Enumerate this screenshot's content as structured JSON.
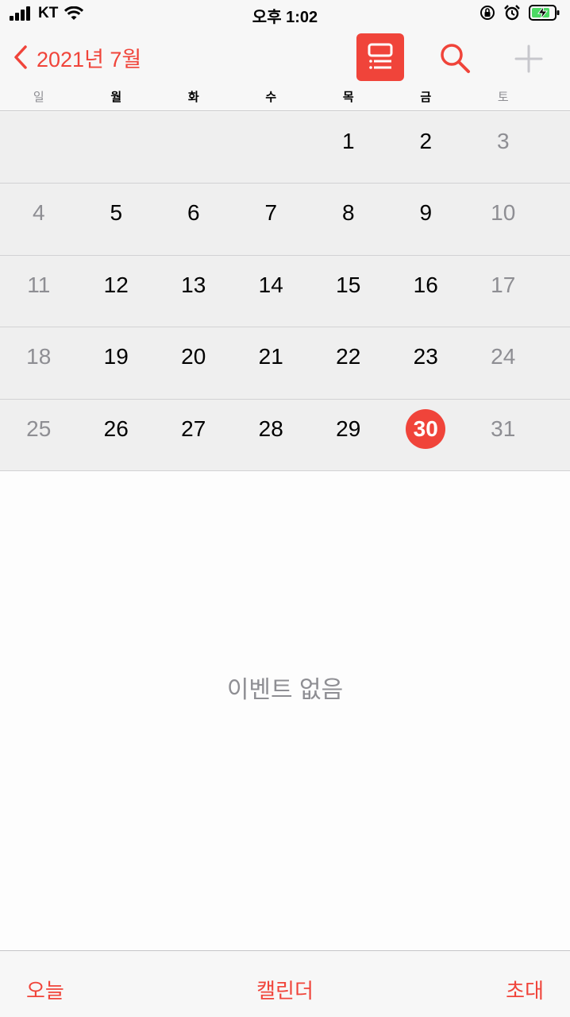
{
  "status_bar": {
    "carrier": "KT",
    "time": "오후 1:02"
  },
  "nav": {
    "back_label": "2021년 7월",
    "icons": [
      "chevron-left-icon",
      "list-view-icon",
      "search-icon",
      "plus-icon"
    ]
  },
  "weekdays": [
    "일",
    "월",
    "화",
    "수",
    "목",
    "금",
    "토"
  ],
  "weeks": [
    [
      "",
      "",
      "",
      "",
      "1",
      "2",
      "3"
    ],
    [
      "4",
      "5",
      "6",
      "7",
      "8",
      "9",
      "10"
    ],
    [
      "11",
      "12",
      "13",
      "14",
      "15",
      "16",
      "17"
    ],
    [
      "18",
      "19",
      "20",
      "21",
      "22",
      "23",
      "24"
    ],
    [
      "25",
      "26",
      "27",
      "28",
      "29",
      "30",
      "31"
    ]
  ],
  "today": "30",
  "events": {
    "empty_text": "이벤트 없음"
  },
  "tabbar": {
    "today": "오늘",
    "calendars": "캘린더",
    "inbox": "초대"
  },
  "colors": {
    "accent": "#f0443a",
    "weekend": "#8e8e93"
  }
}
